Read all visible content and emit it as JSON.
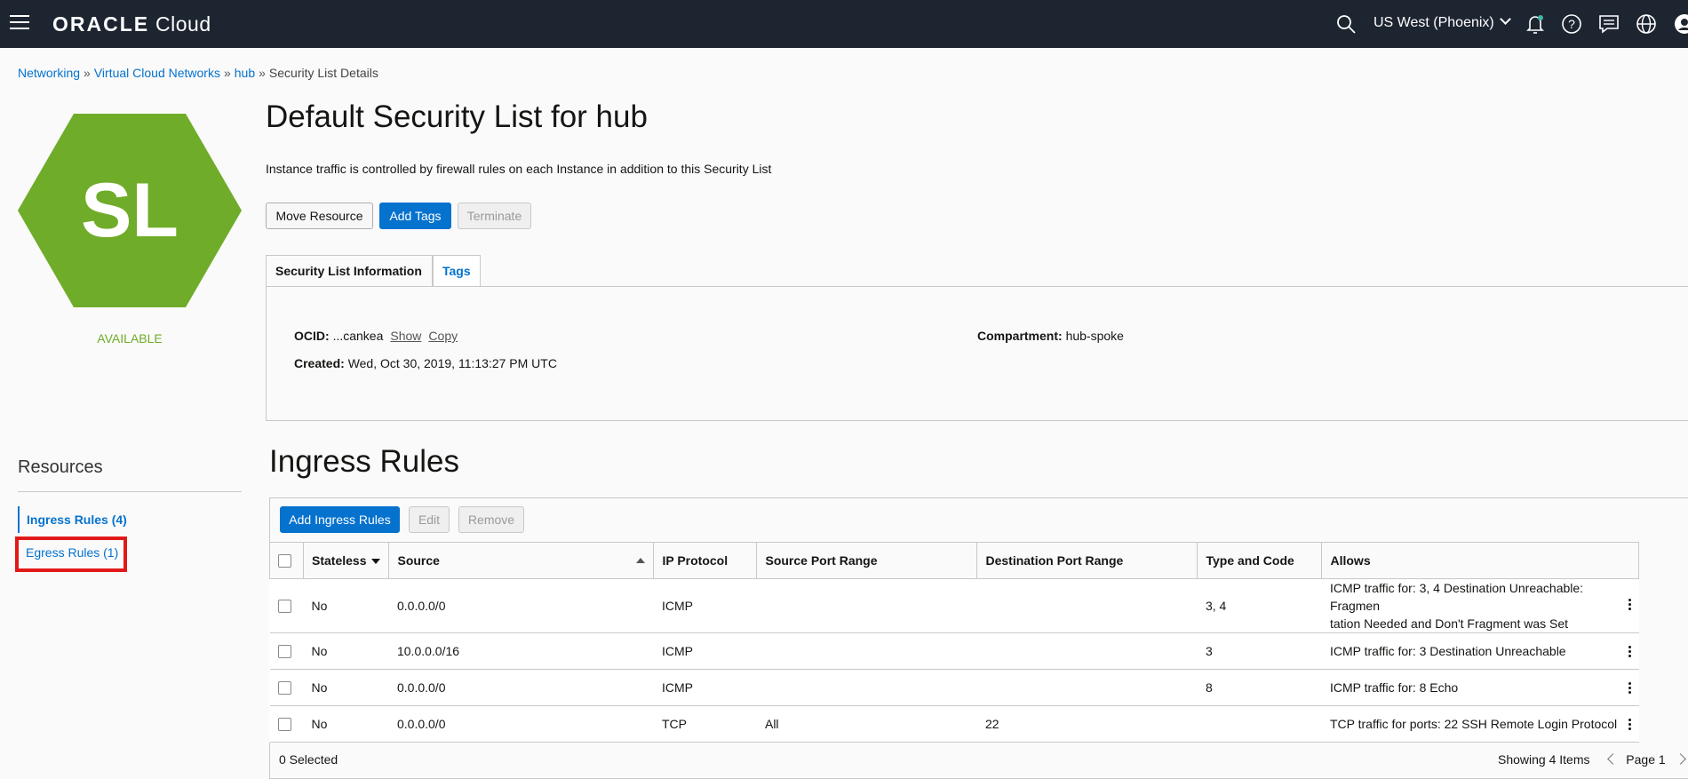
{
  "header": {
    "brand": "ORACLE",
    "product": "Cloud",
    "region": "US West (Phoenix)",
    "icons": [
      "menu-icon",
      "search-icon",
      "chevron-down-icon",
      "bell-icon",
      "help-icon",
      "chat-icon",
      "globe-icon",
      "profile-icon"
    ],
    "bg_color": "#1d2531"
  },
  "breadcrumb": {
    "items": [
      "Networking",
      "Virtual Cloud Networks",
      "hub"
    ],
    "separator": "»",
    "current": "Security List Details"
  },
  "resource_icon": {
    "label": "SL",
    "color": "#6fac29",
    "status": "AVAILABLE"
  },
  "page": {
    "title": "Default Security List for hub",
    "description": "Instance traffic is controlled by firewall rules on each Instance in addition to this Security List"
  },
  "actions": {
    "move": "Move Resource",
    "add_tags": "Add Tags",
    "terminate": "Terminate"
  },
  "tabs": [
    "Security List Information",
    "Tags"
  ],
  "info": {
    "ocid_label": "OCID:",
    "ocid_value": "...cankea",
    "show": "Show",
    "copy": "Copy",
    "created_label": "Created:",
    "created_value": "Wed, Oct 30, 2019, 11:13:27 PM UTC",
    "compartment_label": "Compartment:",
    "compartment_value": "hub-spoke"
  },
  "resources": {
    "heading": "Resources",
    "items": [
      "Ingress Rules (4)",
      "Egress Rules (1)"
    ]
  },
  "ingress": {
    "title": "Ingress Rules",
    "add_button": "Add Ingress Rules",
    "edit_button": "Edit",
    "remove_button": "Remove",
    "columns": [
      "Stateless",
      "Source",
      "IP Protocol",
      "Source Port Range",
      "Destination Port Range",
      "Type and Code",
      "Allows"
    ],
    "rows": [
      {
        "stateless": "No",
        "source": "0.0.0.0/0",
        "protocol": "ICMP",
        "src_port": "",
        "dst_port": "",
        "type_code": "3, 4",
        "allows": "ICMP traffic for: 3, 4 Destination Unreachable: Fragmen",
        "allows2": "tation Needed and Don't Fragment was Set"
      },
      {
        "stateless": "No",
        "source": "10.0.0.0/16",
        "protocol": "ICMP",
        "src_port": "",
        "dst_port": "",
        "type_code": "3",
        "allows": "ICMP traffic for: 3 Destination Unreachable",
        "allows2": ""
      },
      {
        "stateless": "No",
        "source": "0.0.0.0/0",
        "protocol": "ICMP",
        "src_port": "",
        "dst_port": "",
        "type_code": "8",
        "allows": "ICMP traffic for: 8 Echo",
        "allows2": ""
      },
      {
        "stateless": "No",
        "source": "0.0.0.0/0",
        "protocol": "TCP",
        "src_port": "All",
        "dst_port": "22",
        "type_code": "",
        "allows": "TCP traffic for ports: 22 SSH Remote Login Protocol",
        "allows2": ""
      }
    ],
    "selected_text": "0 Selected",
    "showing_text": "Showing 4 Items",
    "page_text": "Page 1"
  }
}
